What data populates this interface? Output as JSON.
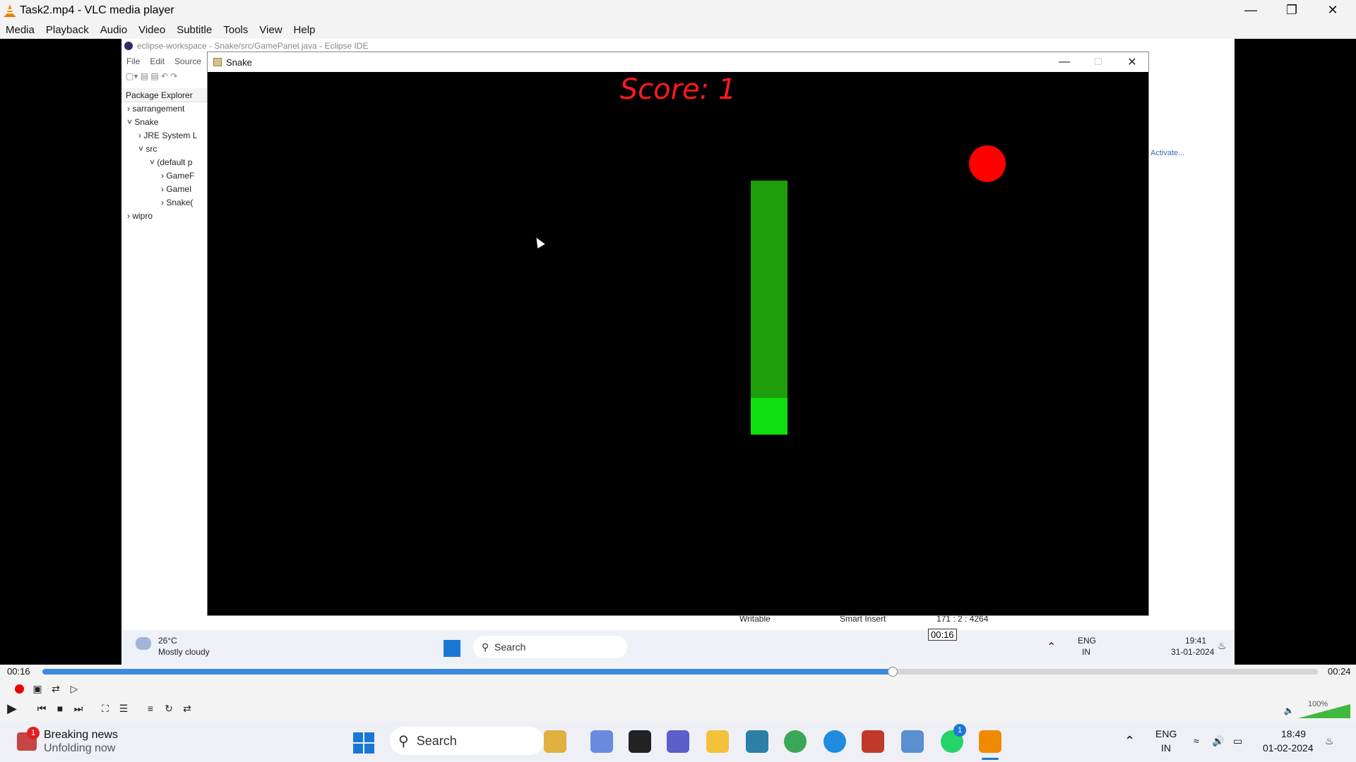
{
  "vlc": {
    "title": "Task2.mp4 - VLC media player",
    "menu": [
      "Media",
      "Playback",
      "Audio",
      "Video",
      "Subtitle",
      "Tools",
      "View",
      "Help"
    ],
    "time_current": "00:16",
    "time_total": "00:24",
    "seek_tooltip": "00:16",
    "progress_fraction": 0.6667,
    "volume_label": "100%",
    "volume_fraction": 1.0
  },
  "eclipse": {
    "title": "eclipse-workspace - Snake/src/GamePanel.java - Eclipse IDE",
    "menu": [
      "File",
      "Edit",
      "Source"
    ],
    "package_explorer_tab": "Package Explorer",
    "tree": [
      "sarrangement",
      "Snake",
      "JRE System L",
      "src",
      "(default p",
      "GameF",
      "GameI",
      "Snake(",
      "wipro"
    ],
    "right_link": "Activate...",
    "status": {
      "writable": "Writable",
      "insert_mode": "Smart Insert",
      "position": "171 : 2 : 4264"
    }
  },
  "snake_window": {
    "title": "Snake",
    "score_text": "Score: 1"
  },
  "inner_taskbar": {
    "weather_temp": "26°C",
    "weather_desc": "Mostly cloudy",
    "search_placeholder": "Search",
    "lang": "ENG",
    "region": "IN",
    "time": "19:41",
    "date": "31-01-2024"
  },
  "taskbar": {
    "news_title": "Breaking news",
    "news_sub": "Unfolding now",
    "news_badge": "1",
    "search_placeholder": "Search",
    "lang": "ENG",
    "region": "IN",
    "time": "18:49",
    "date": "01-02-2024",
    "whatsapp_badge": "1"
  },
  "colors": {
    "score": "#ff1a1a",
    "apple": "#ff0000",
    "snake_body": "#1f9e0b",
    "snake_head": "#10e010",
    "seek_fill": "#3c8ae0"
  }
}
